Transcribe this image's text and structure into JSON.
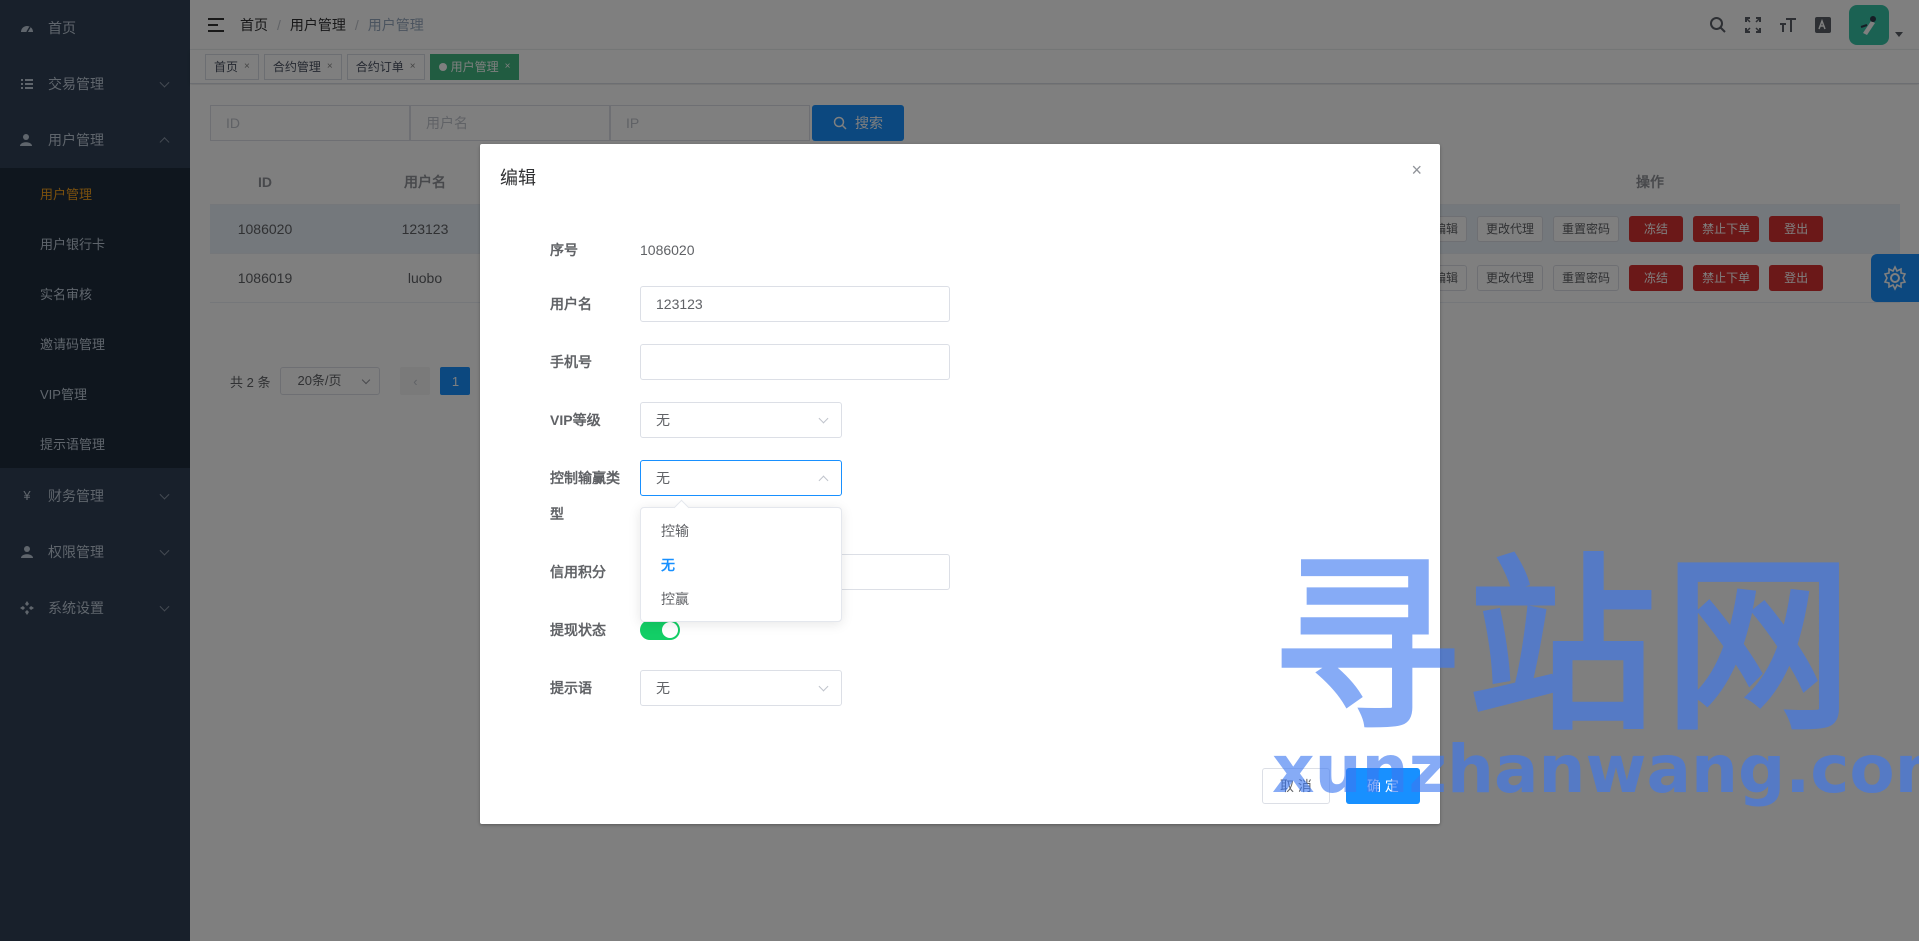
{
  "sidebar": {
    "items": [
      {
        "label": "首页",
        "icon": "dashboard-icon"
      },
      {
        "label": "交易管理",
        "icon": "list-icon"
      },
      {
        "label": "用户管理",
        "icon": "user-icon"
      },
      {
        "label": "财务管理",
        "icon": "yen-icon"
      },
      {
        "label": "权限管理",
        "icon": "person-icon"
      },
      {
        "label": "系统设置",
        "icon": "settings-icon"
      }
    ],
    "user_submenu": [
      "用户管理",
      "用户银行卡",
      "实名审核",
      "邀请码管理",
      "VIP管理",
      "提示语管理"
    ]
  },
  "navbar": {
    "breadcrumb": [
      "首页",
      "用户管理",
      "用户管理"
    ]
  },
  "tags": [
    {
      "label": "首页"
    },
    {
      "label": "合约管理"
    },
    {
      "label": "合约订单"
    },
    {
      "label": "用户管理"
    }
  ],
  "filter": {
    "id_placeholder": "ID",
    "username_placeholder": "用户名",
    "ip_placeholder": "IP",
    "search_label": "搜索"
  },
  "table": {
    "headers": {
      "id": "ID",
      "username": "用户名",
      "ops": "操作"
    },
    "rows": [
      {
        "id": "1086020",
        "username": "123123"
      },
      {
        "id": "1086019",
        "username": "luobo"
      }
    ],
    "ops": [
      "编辑",
      "更改代理",
      "重置密码",
      "冻结",
      "禁止下单",
      "登出"
    ]
  },
  "pagination": {
    "total": "共 2 条",
    "page_size": "20条/页",
    "prev": "‹",
    "current": "1"
  },
  "dialog": {
    "title": "编辑",
    "close": "×",
    "fields": {
      "seq_label": "序号",
      "seq_value": "1086020",
      "username_label": "用户名",
      "username_value": "123123",
      "phone_label": "手机号",
      "phone_value": "",
      "vip_label": "VIP等级",
      "vip_value": "无",
      "control_label_1": "控制输赢类",
      "control_label_2": "型",
      "control_value": "无",
      "credit_label": "信用积分",
      "withdraw_label": "提现状态",
      "withdraw_on": true,
      "tip_label": "提示语",
      "tip_value": "无"
    },
    "dropdown_options": [
      {
        "label": "控输",
        "selected": false
      },
      {
        "label": "无",
        "selected": true
      },
      {
        "label": "控赢",
        "selected": false
      }
    ],
    "cancel_label": "取 消",
    "ok_label": "确 定"
  },
  "watermark": {
    "cn": "寻站网",
    "en": "xunzhanwang.com"
  },
  "colors": {
    "sidebar_bg": "#304156",
    "primary": "#1890ff",
    "danger": "#d63031",
    "active_tag": "#42b983",
    "active_menu": "#f4a01c",
    "switch_on": "#13ce66"
  }
}
